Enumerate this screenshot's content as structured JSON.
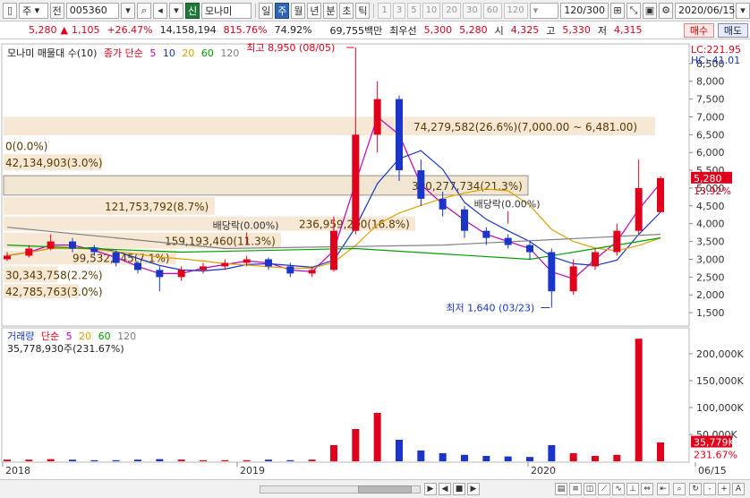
{
  "toolbar": {
    "market_type": "주",
    "prev_label": "전",
    "code": "005360",
    "new_badge": "신",
    "stock_name": "모나미",
    "periods": [
      "일",
      "주",
      "월",
      "년",
      "분",
      "초",
      "틱"
    ],
    "active_period": "주",
    "intervals": [
      "1",
      "3",
      "5",
      "10",
      "20",
      "30",
      "60",
      "120"
    ],
    "count": "120/300",
    "date": "2020/06/15"
  },
  "info": {
    "price": "5,280",
    "change_arrow": "▲",
    "change": "1,105",
    "change_pct": "+26.47%",
    "volume": "14,158,194",
    "vol_ratio": "815.76%",
    "rate": "74.92%",
    "amount": "69,755백만",
    "pref_label": "최우선",
    "ask": "5,300",
    "bid": "5,280",
    "open_label": "시",
    "open": "4,325",
    "high_label": "고",
    "high": "5,330",
    "low_label": "저",
    "low": "4,315",
    "buy_label": "매수",
    "sell_label": "매도"
  },
  "price_panel": {
    "legend_title": "모나미 매물대 수(10)",
    "ma_label": "종가 단순",
    "ma_periods": [
      "5",
      "10",
      "20",
      "60",
      "120"
    ],
    "ma_colors": [
      "#c000c0",
      "#1a35c8",
      "#e0a000",
      "#00a000",
      "#808080"
    ],
    "lc": "LC:221.95",
    "hc": "HC:-41.01",
    "y_ticks": [
      "8,500",
      "8,000",
      "7,500",
      "7,000",
      "6,500",
      "6,000",
      "5,500",
      "5,000",
      "4,500",
      "4,000",
      "3,500",
      "3,000",
      "2,500",
      "2,000",
      "1,500"
    ],
    "current_price_tag": "5,280",
    "current_pct_tag": "13.92%",
    "high_note": "최고 8,950 (08/05)",
    "low_note": "최저 1,640 (03/23)",
    "dividend_note1": "배당락(0.00%)",
    "dividend_note2": "배당락(0.00%)",
    "volume_profile": [
      {
        "label": "74,279,582(26.6%)(7,000.00 ~ 6,481.00)"
      },
      {
        "label": "0(0.0%)"
      },
      {
        "label": "42,134,903(3.0%)"
      },
      {
        "label": "300,277,734(21.3%)"
      },
      {
        "label": "121,753,792(8.7%)"
      },
      {
        "label": "236,959,200(16.8%)"
      },
      {
        "label": "159,193,460(11.3%)"
      },
      {
        "label": "99,532,845(7.1%)"
      },
      {
        "label": "30,343,758(2.2%)"
      },
      {
        "label": "42,785,763(3.0%)"
      }
    ]
  },
  "volume_panel": {
    "legend_title": "거래량",
    "ma_label": "단순",
    "ma_periods": [
      "5",
      "20",
      "60",
      "120"
    ],
    "ma_colors": [
      "#c000c0",
      "#e0a000",
      "#00a000",
      "#808080"
    ],
    "last_volume": "35,778,930주(231.67%)",
    "y_ticks": [
      "200,000K",
      "150,000K",
      "100,000K",
      "50,000K"
    ],
    "current_vol_tag": "35,779K",
    "current_vol_pct": "231.67%"
  },
  "x_axis": {
    "labels": [
      "2018",
      "2019",
      "2020",
      "06/15"
    ]
  },
  "bottom_bar": {
    "buttons": [
      "▶",
      "◀",
      "■",
      "▶",
      "-",
      "+",
      "A"
    ]
  },
  "chart_data": {
    "type": "candlestick",
    "title": "모나미 매물대 수(10)",
    "y_range": [
      1200,
      9000
    ],
    "volume_range": [
      0,
      240000000
    ],
    "candles_weekly_approx": [
      {
        "x": 0,
        "o": 3000,
        "c": 3100,
        "h": 3200,
        "l": 2950
      },
      {
        "x": 1,
        "o": 3100,
        "c": 3300,
        "h": 3400,
        "l": 3050
      },
      {
        "x": 2,
        "o": 3300,
        "c": 3500,
        "h": 3700,
        "l": 3250
      },
      {
        "x": 3,
        "o": 3500,
        "c": 3300,
        "h": 3600,
        "l": 3200
      },
      {
        "x": 4,
        "o": 3300,
        "c": 3200,
        "h": 3400,
        "l": 3100
      },
      {
        "x": 5,
        "o": 3200,
        "c": 2900,
        "h": 3250,
        "l": 2800
      },
      {
        "x": 6,
        "o": 2900,
        "c": 2700,
        "h": 2950,
        "l": 2600
      },
      {
        "x": 7,
        "o": 2700,
        "c": 2500,
        "h": 2800,
        "l": 2100
      },
      {
        "x": 8,
        "o": 2500,
        "c": 2700,
        "h": 2800,
        "l": 2400
      },
      {
        "x": 9,
        "o": 2700,
        "c": 2800,
        "h": 2900,
        "l": 2600
      },
      {
        "x": 10,
        "o": 2800,
        "c": 2900,
        "h": 3000,
        "l": 2700
      },
      {
        "x": 11,
        "o": 2900,
        "c": 3000,
        "h": 3100,
        "l": 2800
      },
      {
        "x": 12,
        "o": 3000,
        "c": 2800,
        "h": 3050,
        "l": 2700
      },
      {
        "x": 13,
        "o": 2800,
        "c": 2600,
        "h": 2900,
        "l": 2500
      },
      {
        "x": 14,
        "o": 2600,
        "c": 2700,
        "h": 2800,
        "l": 2500
      },
      {
        "x": 15,
        "o": 2700,
        "c": 3800,
        "h": 4200,
        "l": 2650
      },
      {
        "x": 16,
        "o": 3800,
        "c": 6500,
        "h": 8950,
        "l": 3700
      },
      {
        "x": 17,
        "o": 6500,
        "c": 7500,
        "h": 8000,
        "l": 6000
      },
      {
        "x": 18,
        "o": 7500,
        "c": 5500,
        "h": 7600,
        "l": 5200
      },
      {
        "x": 19,
        "o": 5500,
        "c": 4700,
        "h": 5800,
        "l": 4500
      },
      {
        "x": 20,
        "o": 4700,
        "c": 4400,
        "h": 4900,
        "l": 4200
      },
      {
        "x": 21,
        "o": 4400,
        "c": 3800,
        "h": 4500,
        "l": 3600
      },
      {
        "x": 22,
        "o": 3800,
        "c": 3600,
        "h": 3900,
        "l": 3400
      },
      {
        "x": 23,
        "o": 3600,
        "c": 3400,
        "h": 3700,
        "l": 3300
      },
      {
        "x": 24,
        "o": 3400,
        "c": 3200,
        "h": 3500,
        "l": 3000
      },
      {
        "x": 25,
        "o": 3200,
        "c": 2100,
        "h": 3300,
        "l": 1640
      },
      {
        "x": 26,
        "o": 2100,
        "c": 2800,
        "h": 3000,
        "l": 2000
      },
      {
        "x": 27,
        "o": 2800,
        "c": 3200,
        "h": 3300,
        "l": 2700
      },
      {
        "x": 28,
        "o": 3200,
        "c": 3800,
        "h": 4000,
        "l": 3100
      },
      {
        "x": 29,
        "o": 3800,
        "c": 5000,
        "h": 5800,
        "l": 3700
      },
      {
        "x": 30,
        "o": 4325,
        "c": 5280,
        "h": 5330,
        "l": 4315
      }
    ]
  }
}
